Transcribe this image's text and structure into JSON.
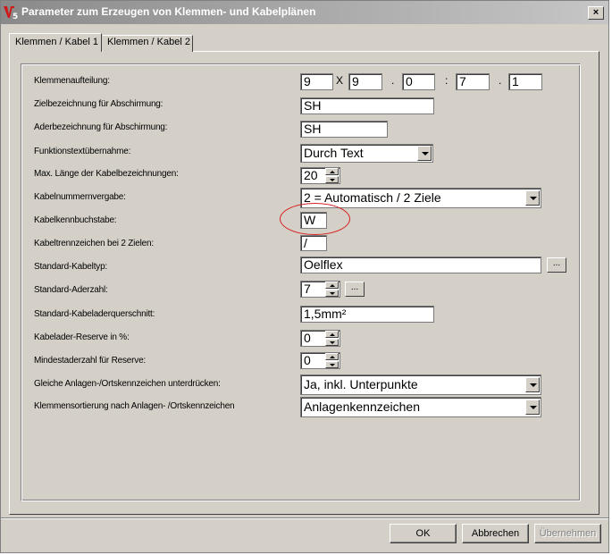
{
  "window": {
    "title": "Parameter zum Erzeugen von Klemmen- und Kabelplänen",
    "close_glyph": "×"
  },
  "tabs": [
    {
      "label": "Klemmen / Kabel 1",
      "active": true
    },
    {
      "label": "Klemmen / Kabel 2",
      "active": false
    }
  ],
  "form": {
    "klemmenaufteilung": {
      "label": "Klemmenaufteilung:",
      "values": [
        "9",
        "9",
        "0",
        "7",
        "1"
      ],
      "separators": [
        "X",
        ".",
        ":",
        "."
      ]
    },
    "zielbezeichnung": {
      "label": "Zielbezeichnung für Abschirmung:",
      "value": "SH"
    },
    "aderbezeichnung": {
      "label": "Aderbezeichnung für Abschirmung:",
      "value": "SH"
    },
    "funktionstext": {
      "label": "Funktionstextübernahme:",
      "value": "Durch Text"
    },
    "max_laenge": {
      "label": "Max. Länge der Kabelbezeichnungen:",
      "value": "20"
    },
    "kabelnummernvergabe": {
      "label": "Kabelnummernvergabe:",
      "value": "2 = Automatisch / 2 Ziele"
    },
    "kabelkennbuchstabe": {
      "label": "Kabelkennbuchstabe:",
      "value": "W"
    },
    "kabeltrennzeichen": {
      "label": "Kabeltrennzeichen bei 2 Zielen:",
      "value": "/"
    },
    "standard_kabeltyp": {
      "label": "Standard-Kabeltyp:",
      "value": "Oelflex",
      "button": "..."
    },
    "standard_aderzahl": {
      "label": "Standard-Aderzahl:",
      "value": "7",
      "button": "..."
    },
    "standard_querschnitt": {
      "label": "Standard-Kabeladerquerschnitt:",
      "value": "1,5mm²"
    },
    "reserve_prozent": {
      "label": "Kabelader-Reserve in %:",
      "value": "0"
    },
    "mindestaderzahl": {
      "label": "Mindestaderzahl für Reserve:",
      "value": "0"
    },
    "gleiche_kennzeichen": {
      "label": "Gleiche Anlagen-/Ortskennzeichen unterdrücken:",
      "value": "Ja, inkl. Unterpunkte"
    },
    "klemmensortierung": {
      "label": "Klemmensortierung nach Anlagen- /Ortskennzeichen",
      "value": "Anlagenkennzeichen"
    }
  },
  "buttons": {
    "ok": "OK",
    "cancel": "Abbrechen",
    "apply": "Übernehmen"
  },
  "colors": {
    "dialog_face": "#d4d0c8",
    "annotation": "#d62020"
  }
}
